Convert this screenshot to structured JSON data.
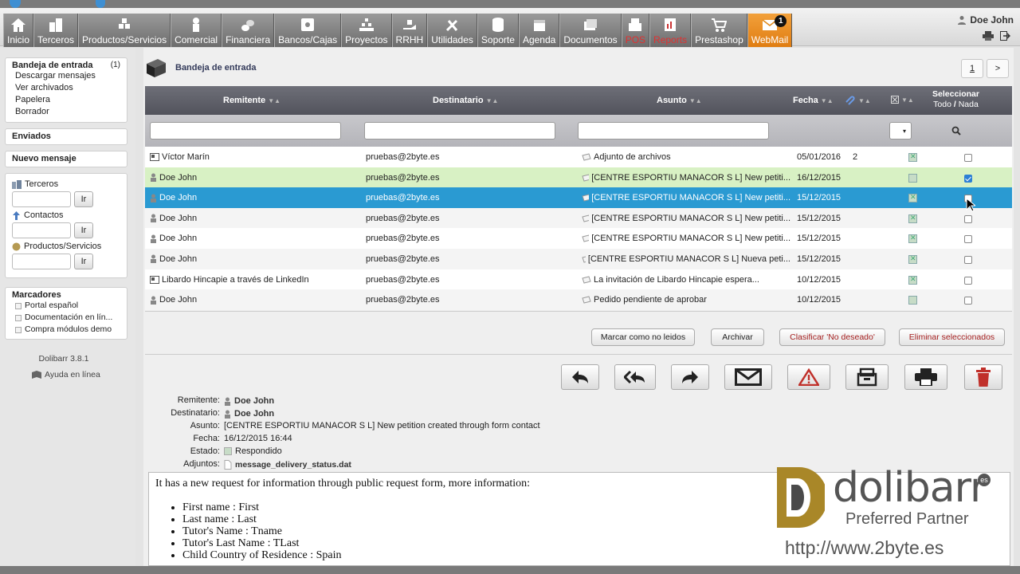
{
  "menu": [
    {
      "label": "Inicio",
      "icon": "house-icon"
    },
    {
      "label": "Terceros",
      "icon": "buildings-icon"
    },
    {
      "label": "Productos/Servicios",
      "icon": "boxes-icon"
    },
    {
      "label": "Comercial",
      "icon": "person-icon"
    },
    {
      "label": "Financiera",
      "icon": "coins-icon"
    },
    {
      "label": "Bancos/Cajas",
      "icon": "safe-icon"
    },
    {
      "label": "Proyectos",
      "icon": "pyramid-icon"
    },
    {
      "label": "RRHH",
      "icon": "hand-icon"
    },
    {
      "label": "Utilidades",
      "icon": "tools-icon"
    },
    {
      "label": "Soporte",
      "icon": "database-icon"
    },
    {
      "label": "Agenda",
      "icon": "calendar-icon"
    },
    {
      "label": "Documentos",
      "icon": "folders-icon"
    },
    {
      "label": "POS",
      "icon": "cash-register-icon"
    },
    {
      "label": "Reports",
      "icon": "report-icon"
    },
    {
      "label": "Prestashop",
      "icon": "cart-icon"
    },
    {
      "label": "WebMail",
      "icon": "envelope-icon",
      "badge": "1"
    }
  ],
  "user": {
    "name": "Doe John"
  },
  "sidebar": {
    "inbox": {
      "title": "Bandeja de entrada",
      "count": "(1)",
      "items": [
        "Descargar mensajes",
        "Ver archivados",
        "Papelera",
        "Borrador"
      ]
    },
    "sent": "Enviados",
    "new_message": "Nuevo mensaje",
    "search": {
      "terceros": "Terceros",
      "contactos": "Contactos",
      "productos": "Productos/Servicios",
      "go": "Ir"
    },
    "bookmarks": {
      "title": "Marcadores",
      "items": [
        "Portal español",
        "Documentación en lín...",
        "Compra módulos demo"
      ]
    },
    "version": "Dolibarr 3.8.1",
    "help": "Ayuda en línea"
  },
  "main": {
    "title": "Bandeja de entrada",
    "pager": {
      "page": "1",
      "next": ">"
    },
    "columns": {
      "sender": "Remitente",
      "recipient": "Destinatario",
      "subject": "Asunto",
      "date": "Fecha",
      "select": "Seleccionar",
      "all": "Todo",
      "none": "Nada",
      "sep": "/"
    },
    "rows": [
      {
        "sender": "Víctor Marín",
        "recipient": "pruebas@2byte.es",
        "subject": "Adjunto de archivos",
        "date": "05/01/2016",
        "att": "2",
        "status": "x",
        "checked": false,
        "style": "odd",
        "sicon": "card"
      },
      {
        "sender": "Doe John",
        "recipient": "pruebas@2byte.es",
        "subject": "[CENTRE ESPORTIU MANACOR S L] New petiti...",
        "date": "16/12/2015",
        "att": "",
        "status": "plain",
        "checked": true,
        "style": "green",
        "sicon": "user"
      },
      {
        "sender": "Doe John",
        "recipient": "pruebas@2byte.es",
        "subject": "[CENTRE ESPORTIU MANACOR S L] New petiti...",
        "date": "15/12/2015",
        "att": "",
        "status": "x",
        "checked": false,
        "style": "blue",
        "sicon": "user"
      },
      {
        "sender": "Doe John",
        "recipient": "pruebas@2byte.es",
        "subject": "[CENTRE ESPORTIU MANACOR S L] New petiti...",
        "date": "15/12/2015",
        "att": "",
        "status": "x",
        "checked": false,
        "style": "even",
        "sicon": "user"
      },
      {
        "sender": "Doe John",
        "recipient": "pruebas@2byte.es",
        "subject": "[CENTRE ESPORTIU MANACOR S L] New petiti...",
        "date": "15/12/2015",
        "att": "",
        "status": "x",
        "checked": false,
        "style": "odd",
        "sicon": "user"
      },
      {
        "sender": "Doe John",
        "recipient": "pruebas@2byte.es",
        "subject": "[CENTRE ESPORTIU MANACOR S L] Nueva peti...",
        "date": "15/12/2015",
        "att": "",
        "status": "x",
        "checked": false,
        "style": "even",
        "sicon": "user"
      },
      {
        "sender": "Libardo Hincapie a través de LinkedIn",
        "recipient": "pruebas@2byte.es",
        "subject": "La invitación de Libardo Hincapie espera...",
        "date": "10/12/2015",
        "att": "",
        "status": "x",
        "checked": false,
        "style": "odd",
        "sicon": "card"
      },
      {
        "sender": "Doe John",
        "recipient": "pruebas@2byte.es",
        "subject": "Pedido pendiente de aprobar",
        "date": "10/12/2015",
        "att": "",
        "status": "plain",
        "checked": false,
        "style": "even",
        "sicon": "user"
      }
    ],
    "actions": {
      "mark_unread": "Marcar como no leidos",
      "archive": "Archivar",
      "spam": "Clasificar 'No deseado'",
      "delete": "Eliminar seleccionados"
    },
    "detail": {
      "labels": {
        "from": "Remitente:",
        "to": "Destinatario:",
        "subject": "Asunto:",
        "date": "Fecha:",
        "state": "Estado:",
        "attachments": "Adjuntos:"
      },
      "from": "Doe John",
      "to": "Doe John",
      "subject": "[CENTRE ESPORTIU MANACOR S L] New petition created through form contact",
      "date": "16/12/2015 16:44",
      "state": "Respondido",
      "attachment": "message_delivery_status.dat"
    },
    "body": {
      "intro": "It has a new request for information through public request form, more information:",
      "items": [
        "First name : First",
        "Last name : Last",
        "Tutor's Name : Tname",
        "Tutor's Last Name : TLast",
        "Child Country of Residence : Spain"
      ]
    }
  },
  "watermark": {
    "brand": "dolibarr",
    "tag": "Preferred Partner",
    "es": "es",
    "url": "http://www.2byte.es",
    "letter": "D"
  },
  "colors": {
    "selected_row": "#2a9ad2",
    "checked_row": "#d8f1c4",
    "active_menu": "#f2a03a",
    "red_label": "#e23030",
    "trash": "#c0302a"
  }
}
